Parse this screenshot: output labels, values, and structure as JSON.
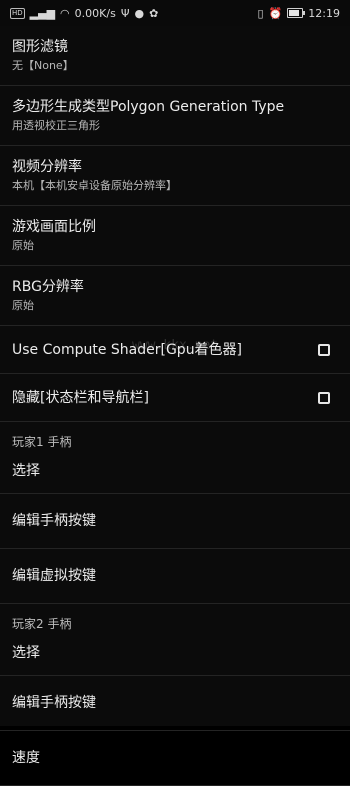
{
  "status_bar": {
    "sim_label": "HD",
    "speed": "0.00K/s",
    "time": "12:19",
    "battery_level_pct": 85,
    "left_icons": [
      "signal-icon",
      "wifi-icon",
      "usb-icon",
      "wechat-icon",
      "paw-icon"
    ],
    "right_icons": [
      "vibrate-icon",
      "alarm-icon",
      "battery-icon"
    ]
  },
  "settings": {
    "graphics_filter": {
      "title": "图形滤镜",
      "value": "无【None】"
    },
    "polygon_type": {
      "title": "多边形生成类型Polygon Generation Type",
      "value": "用透视校正三角形"
    },
    "video_resolution": {
      "title": "视频分辨率",
      "value": "本机【本机安卓设备原始分辨率】"
    },
    "aspect_ratio": {
      "title": "游戏画面比例",
      "value": "原始"
    },
    "rgb_resolution": {
      "title": "RBG分辨率",
      "value": "原始"
    },
    "compute_shader": {
      "title": "Use Compute Shader[Gpu着色器]",
      "checked": false
    },
    "hide_bars": {
      "title": "隐藏[状态栏和导航栏]",
      "checked": false
    },
    "player1": {
      "section": "玩家1 手柄",
      "select": "选择",
      "edit_buttons": "编辑手柄按键",
      "edit_virtual": "编辑虚拟按键"
    },
    "player2": {
      "section": "玩家2 手柄",
      "select": "选择",
      "edit_buttons": "编辑手柄按键",
      "partial_next": "速度"
    }
  },
  "watermark": "www.kkx.net"
}
